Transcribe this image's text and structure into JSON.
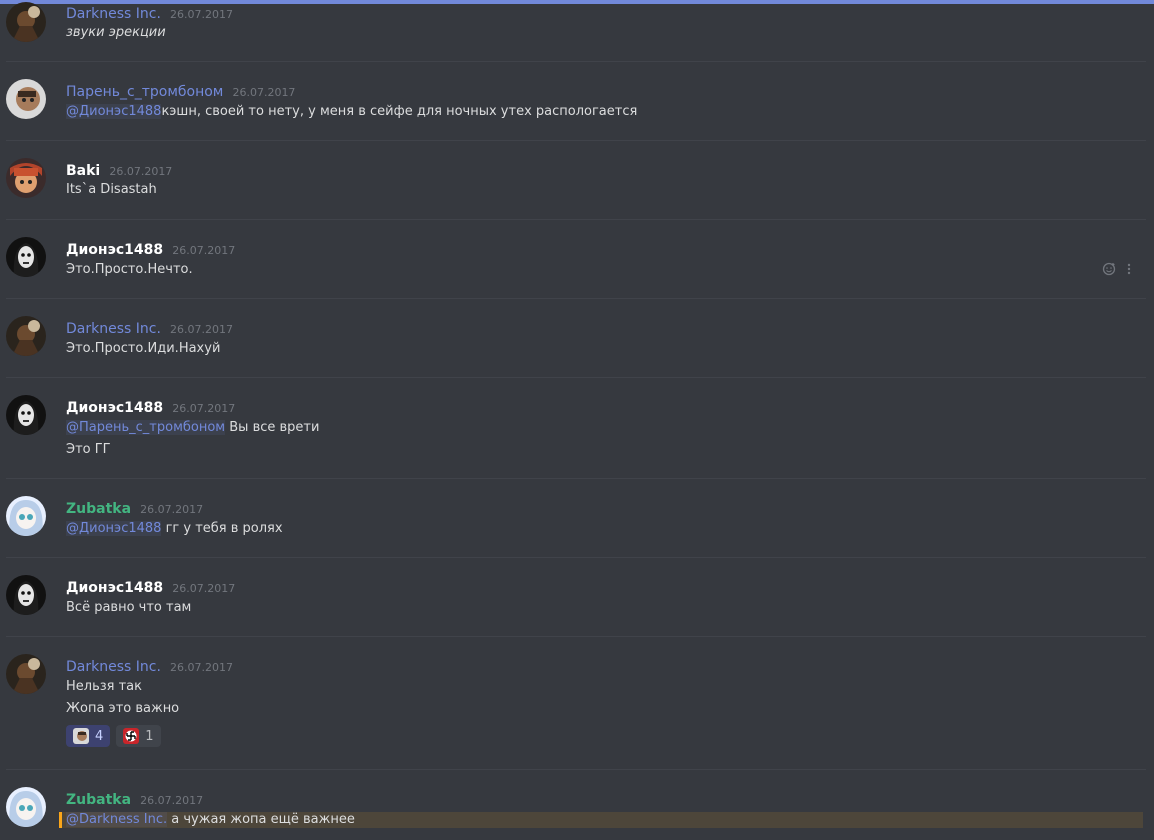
{
  "messages": [
    {
      "author": "Darkness Inc.",
      "time": "26.07.2017",
      "lines": [
        "звуки эрекции"
      ]
    },
    {
      "author": "Парень_с_тромбоном",
      "time": "26.07.2017",
      "mention": "@Дионэс1488",
      "text": "кэшн, своей то нету, у меня в сейфе для ночных утех распологается"
    },
    {
      "author": "Baki",
      "time": "26.07.2017",
      "lines": [
        "Its`a Disastah"
      ]
    },
    {
      "author": "Дионэс1488",
      "time": "26.07.2017",
      "lines": [
        "Это.Просто.Нечто."
      ]
    },
    {
      "author": "Darkness Inc.",
      "time": "26.07.2017",
      "lines": [
        "Это.Просто.Иди.Нахуй"
      ]
    },
    {
      "author": "Дионэс1488",
      "time": "26.07.2017",
      "mention": "@Парень_с_тромбоном",
      "text": " Вы все врети",
      "lines": [
        "Это ГГ"
      ]
    },
    {
      "author": "Zubatka",
      "time": "26.07.2017",
      "mention": "@Дионэс1488",
      "text": " гг у тебя в ролях"
    },
    {
      "author": "Дионэс1488",
      "time": "26.07.2017",
      "lines": [
        "Всё равно что там"
      ]
    },
    {
      "author": "Darkness Inc.",
      "time": "26.07.2017",
      "lines": [
        "Нельзя так",
        "Жопа это важно"
      ],
      "reactions": [
        {
          "emoji": "avatar-face-emoji",
          "count": "4"
        },
        {
          "emoji": "swastika-emoji",
          "count": "1"
        }
      ]
    },
    {
      "author": "Zubatka",
      "time": "26.07.2017",
      "mention": "@Darkness Inc.",
      "text": " а чужая жопа ещё важнее"
    }
  ],
  "colors": {
    "background": "#36393f",
    "mention": "#7289da",
    "author_blue": "#7289da",
    "author_white": "#ffffff",
    "author_green": "#43b581",
    "timestamp": "#72767d",
    "highlight": "#faa61a"
  },
  "icons": {
    "add_reaction": "add-reaction-icon",
    "more": "more-options-icon"
  }
}
